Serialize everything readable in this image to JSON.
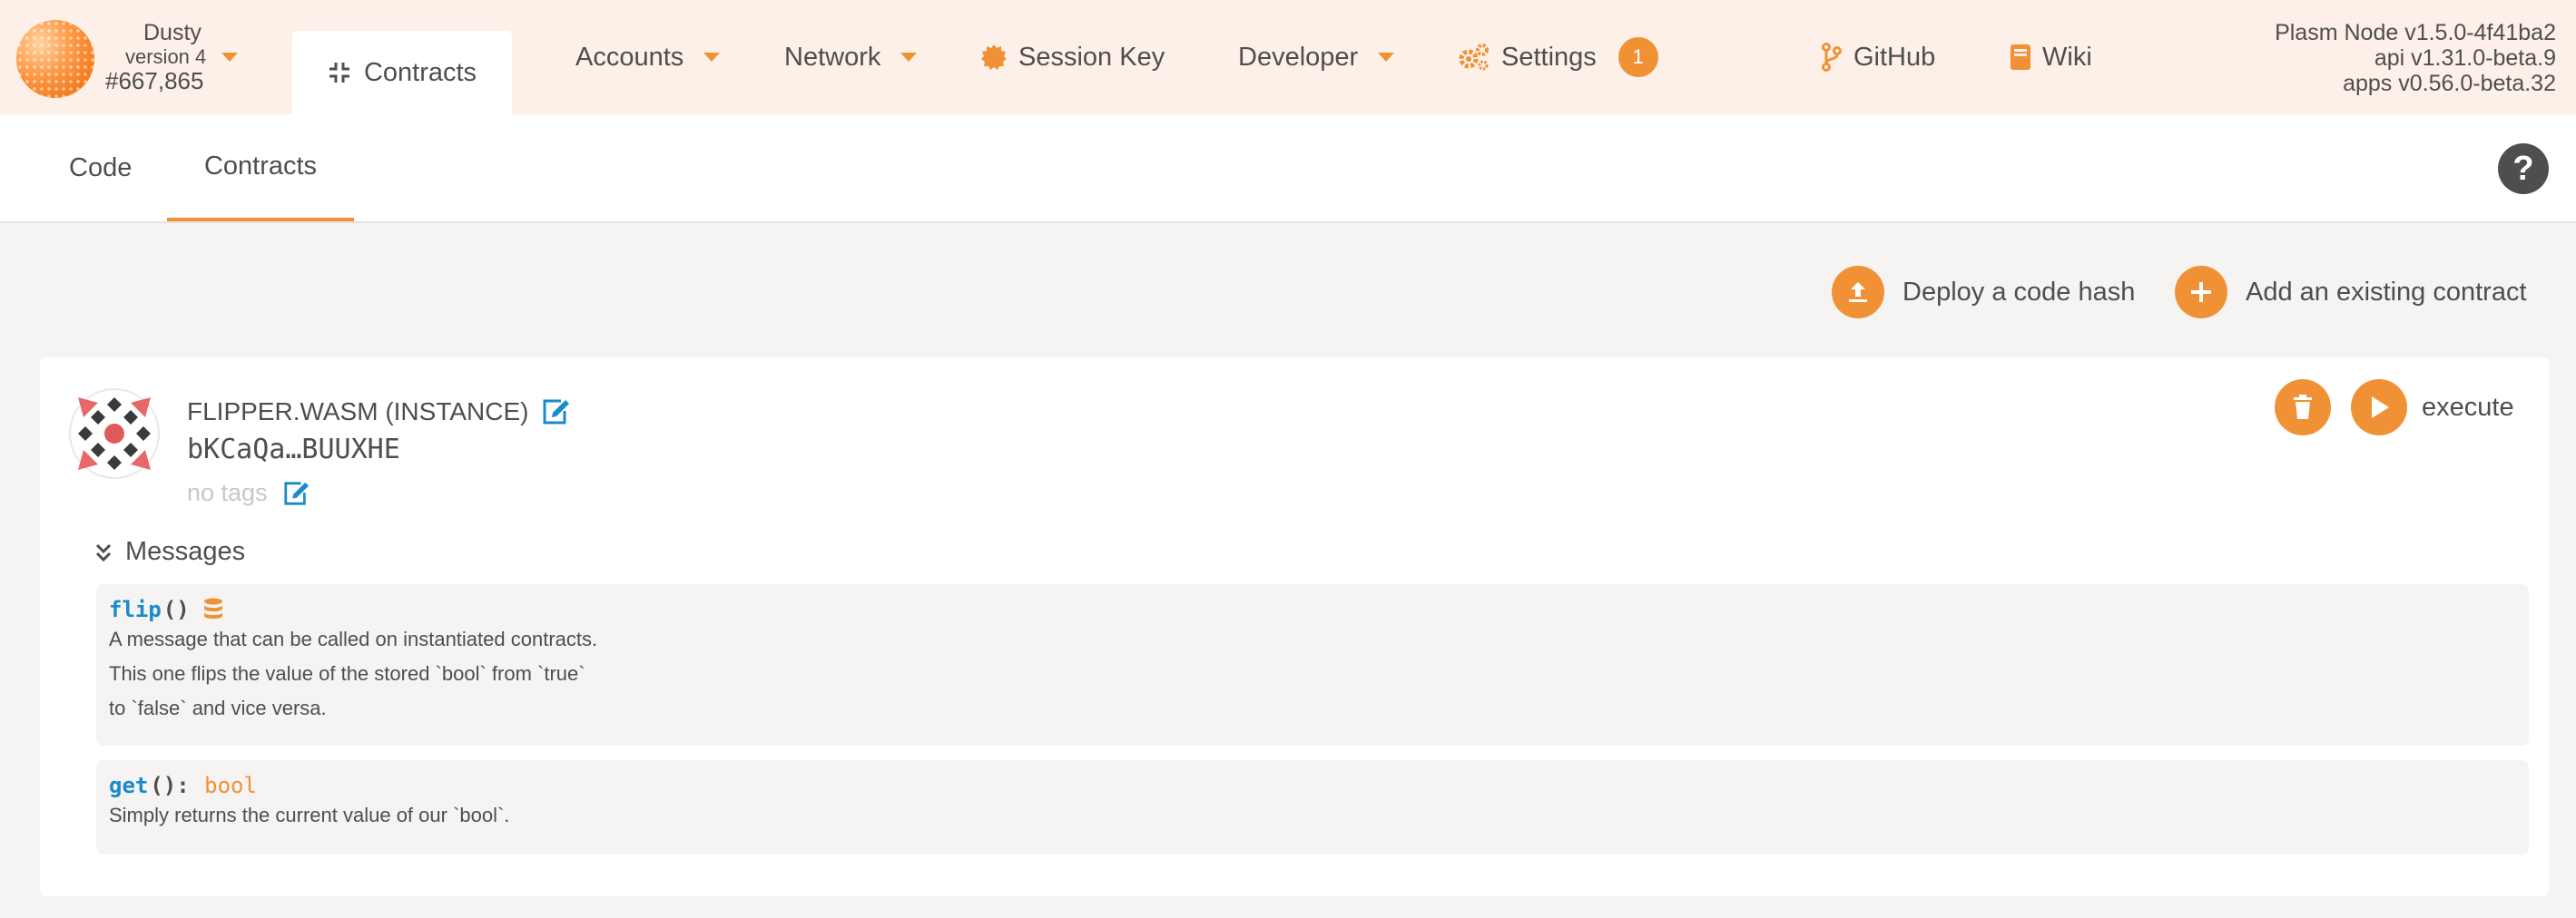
{
  "chain": {
    "name": "Dusty",
    "version": "version 4",
    "block": "#667,865"
  },
  "nav": {
    "contracts": "Contracts",
    "accounts": "Accounts",
    "network": "Network",
    "session_key": "Session Key",
    "developer": "Developer",
    "settings": "Settings",
    "settings_badge": "1",
    "github": "GitHub",
    "wiki": "Wiki"
  },
  "versions": {
    "node": "Plasm Node v1.5.0-4f41ba2",
    "api": "api v1.31.0-beta.9",
    "apps": "apps v0.56.0-beta.32"
  },
  "subtabs": {
    "code": "Code",
    "contracts": "Contracts",
    "help": "?"
  },
  "actions": {
    "deploy": "Deploy a code hash",
    "add": "Add an existing contract"
  },
  "contract": {
    "name": "FLIPPER.WASM (INSTANCE)",
    "address": "bKCaQa…BUUXHE",
    "tags": "no tags",
    "execute": "execute",
    "messages_label": "Messages",
    "messages": [
      {
        "fn": "flip",
        "args": "()",
        "returns": "",
        "doc": [
          "A message that can be called on instantiated contracts.",
          "This one flips the value of the stored `bool` from `true`",
          "to `false` and vice versa."
        ]
      },
      {
        "fn": "get",
        "args": "(): ",
        "returns": "bool",
        "doc": [
          "Simply returns the current value of our `bool`."
        ]
      }
    ]
  },
  "colors": {
    "accent": "#f19135",
    "link": "#1a8bca",
    "topbar": "#fdf0e8"
  }
}
